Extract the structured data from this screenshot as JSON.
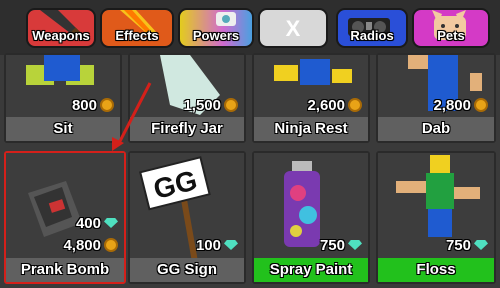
{
  "tabs": [
    {
      "label": "Weapons",
      "color": "#d83a3a"
    },
    {
      "label": "Effects",
      "color": "#e05a1a"
    },
    {
      "label": "Powers",
      "color": "#e3cc1e"
    },
    {
      "label": "X",
      "color": "#d8d8d8"
    },
    {
      "label": "Radios",
      "color": "#2a4fd8"
    },
    {
      "label": "Pets",
      "color": "#d43ac6"
    }
  ],
  "items": [
    {
      "name": "Sit",
      "price": "800",
      "currency": "coin-icon"
    },
    {
      "name": "Firefly Jar",
      "price": "1,500",
      "currency": "coin-icon"
    },
    {
      "name": "Ninja Rest",
      "price": "2,600",
      "currency": "coin-icon"
    },
    {
      "name": "Dab",
      "price": "2,800",
      "currency": "coin-icon"
    },
    {
      "name": "Prank Bomb",
      "price_gems": "400",
      "price_coins": "4,800"
    },
    {
      "name": "GG Sign",
      "price": "100",
      "currency": "gem-icon",
      "sign_text": "GG"
    },
    {
      "name": "Spray Paint",
      "price": "750",
      "currency": "gem-icon"
    },
    {
      "name": "Floss",
      "price": "750",
      "currency": "gem-icon"
    }
  ]
}
